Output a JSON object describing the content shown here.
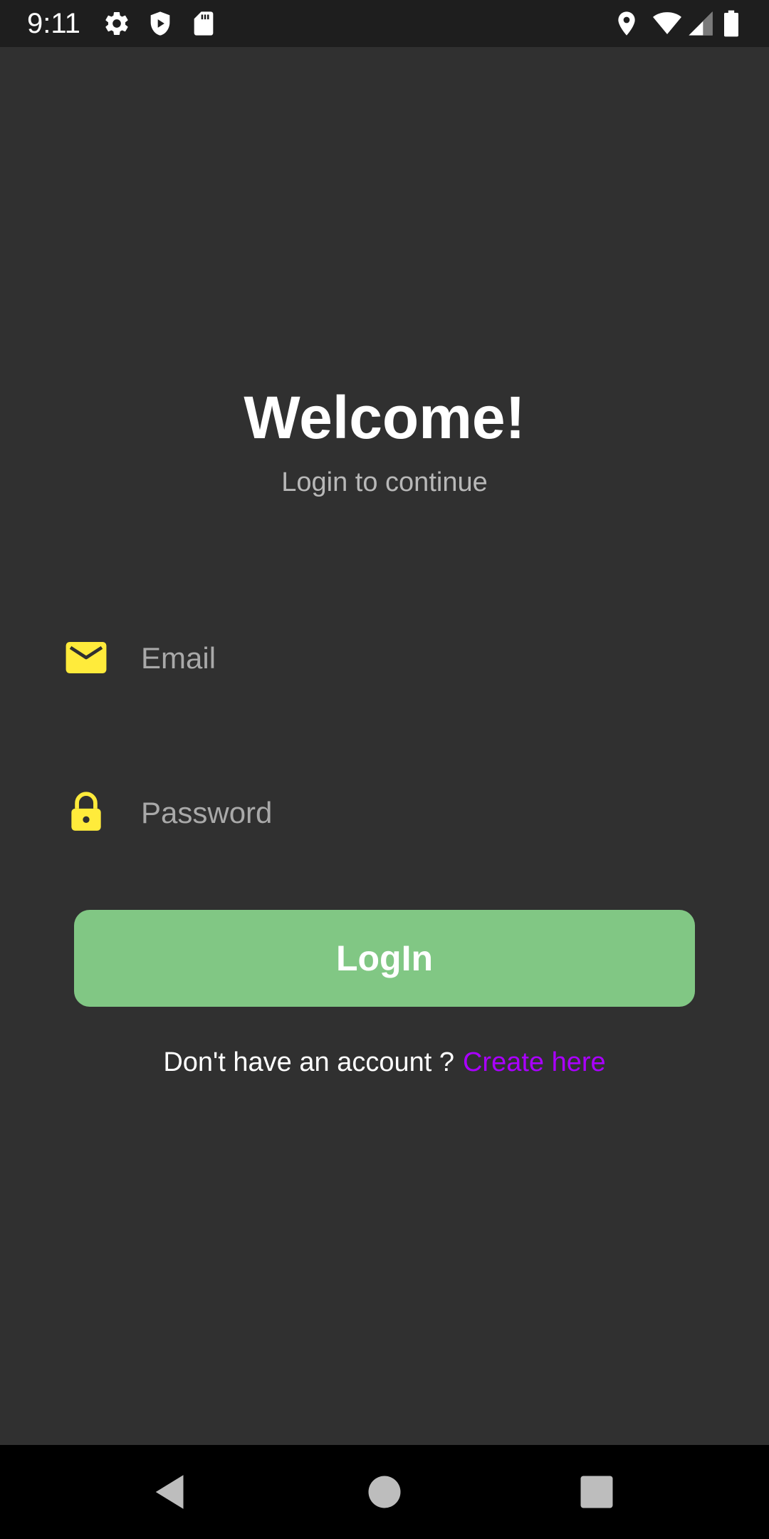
{
  "status_bar": {
    "time": "9:11",
    "icons_left": [
      "gear-icon",
      "shield-icon",
      "sd-card-icon"
    ],
    "icons_right": [
      "location-icon",
      "wifi-icon",
      "cell-signal-icon",
      "battery-icon"
    ]
  },
  "login": {
    "title": "Welcome!",
    "subtitle": "Login to continue",
    "email": {
      "icon": "mail-icon",
      "placeholder": "Email",
      "value": ""
    },
    "password": {
      "icon": "lock-icon",
      "placeholder": "Password",
      "value": ""
    },
    "button_label": "LogIn",
    "signup_prompt": "Don't have an account ?",
    "signup_link": "Create here"
  },
  "nav_bar": {
    "buttons": [
      "back-icon",
      "home-icon",
      "recents-icon"
    ]
  },
  "colors": {
    "background": "#303030",
    "status_bar": "#1e1e1e",
    "nav_bar": "#000000",
    "icon_accent": "#ffeb3b",
    "button": "#81c784",
    "link": "#aa00ff",
    "placeholder": "#a9a9a9",
    "subtitle": "#b8b8b8"
  }
}
